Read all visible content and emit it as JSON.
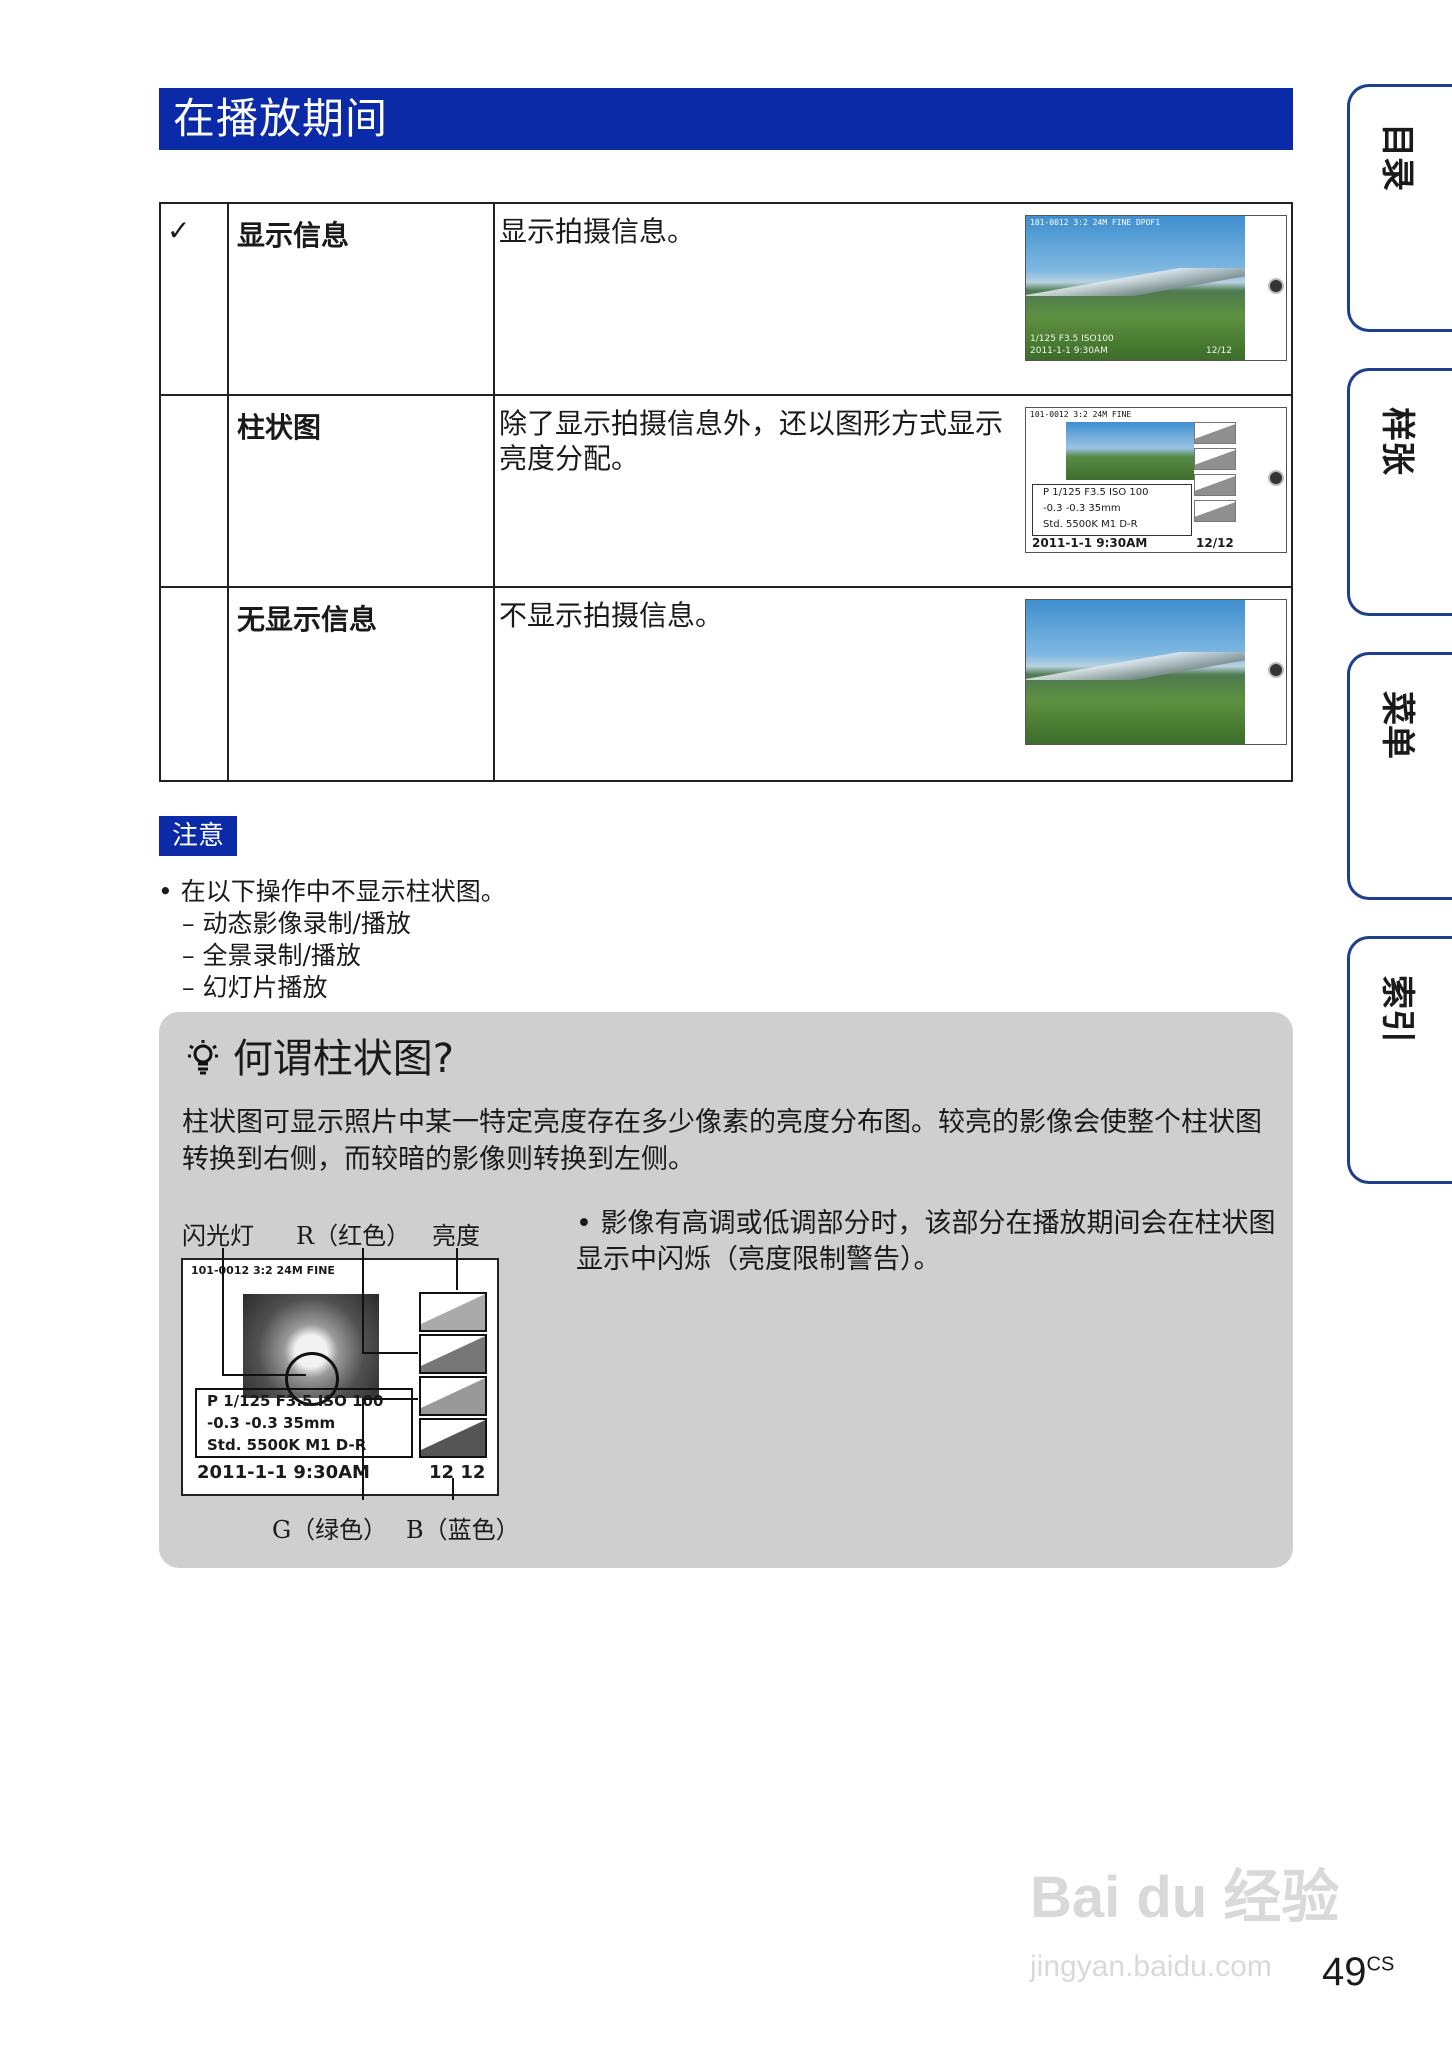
{
  "header": {
    "title": "在播放期间"
  },
  "table": {
    "rows": [
      {
        "check": "✓",
        "name": "显示信息",
        "desc": "显示拍摄信息。",
        "osd_top": "101-0012 3:2 24M FINE DPOF1",
        "osd_bottom_left": "1/125   F3.5   ISO100",
        "osd_date": "2011-1-1   9:30AM",
        "osd_count": "12/12"
      },
      {
        "check": "",
        "name": "柱状图",
        "desc": "除了显示拍摄信息外，还以图形方式显示亮度分配。",
        "osd_top": "101-0012 3:2 24M FINE",
        "info_line1": "P    1/125    F3.5    ISO 100",
        "info_line2": "-0.3   -0.3   35mm",
        "info_line3": "Std.  5500K  M1  D-R",
        "date": "2011-1-1  9:30AM",
        "count": "12/12"
      },
      {
        "check": "",
        "name": "无显示信息",
        "desc": "不显示拍摄信息。"
      }
    ]
  },
  "note": {
    "tag": "注意",
    "bullet": "• 在以下操作中不显示柱状图。",
    "items": [
      "– 动态影像录制/播放",
      "– 全景录制/播放",
      "– 幻灯片播放"
    ]
  },
  "hint": {
    "icon": "lightbulb-icon",
    "title": "何谓柱状图?",
    "body": "柱状图可显示照片中某一特定亮度存在多少像素的亮度分布图。较亮的影像会使整个柱状图转换到右侧，而较暗的影像则转换到左侧。",
    "labels_top": [
      "闪光灯",
      "R（红色）",
      "亮度"
    ],
    "labels_bottom": [
      "G（绿色）",
      "B（蓝色）"
    ],
    "bullet": "• 影像有高调或低调部分时，该部分在播放期间会在柱状图显示中闪烁（亮度限制警告）。",
    "diagram": {
      "top": "101-0012 3:2 24M FINE",
      "info_line1": "P    1/125    F3.5    ISO 100",
      "info_line2": "-0.3    -0.3    35mm",
      "info_line3": "Std.    5500K  M1   D-R",
      "date": "2011-1-1  9:30AM",
      "count": "12 12"
    }
  },
  "side_tabs": [
    "目录",
    "样张",
    "菜单",
    "索引"
  ],
  "page": {
    "number": "49",
    "suffix": "CS"
  },
  "watermark": {
    "main": "Bai du 经验",
    "url": "jingyan.baidu.com"
  }
}
